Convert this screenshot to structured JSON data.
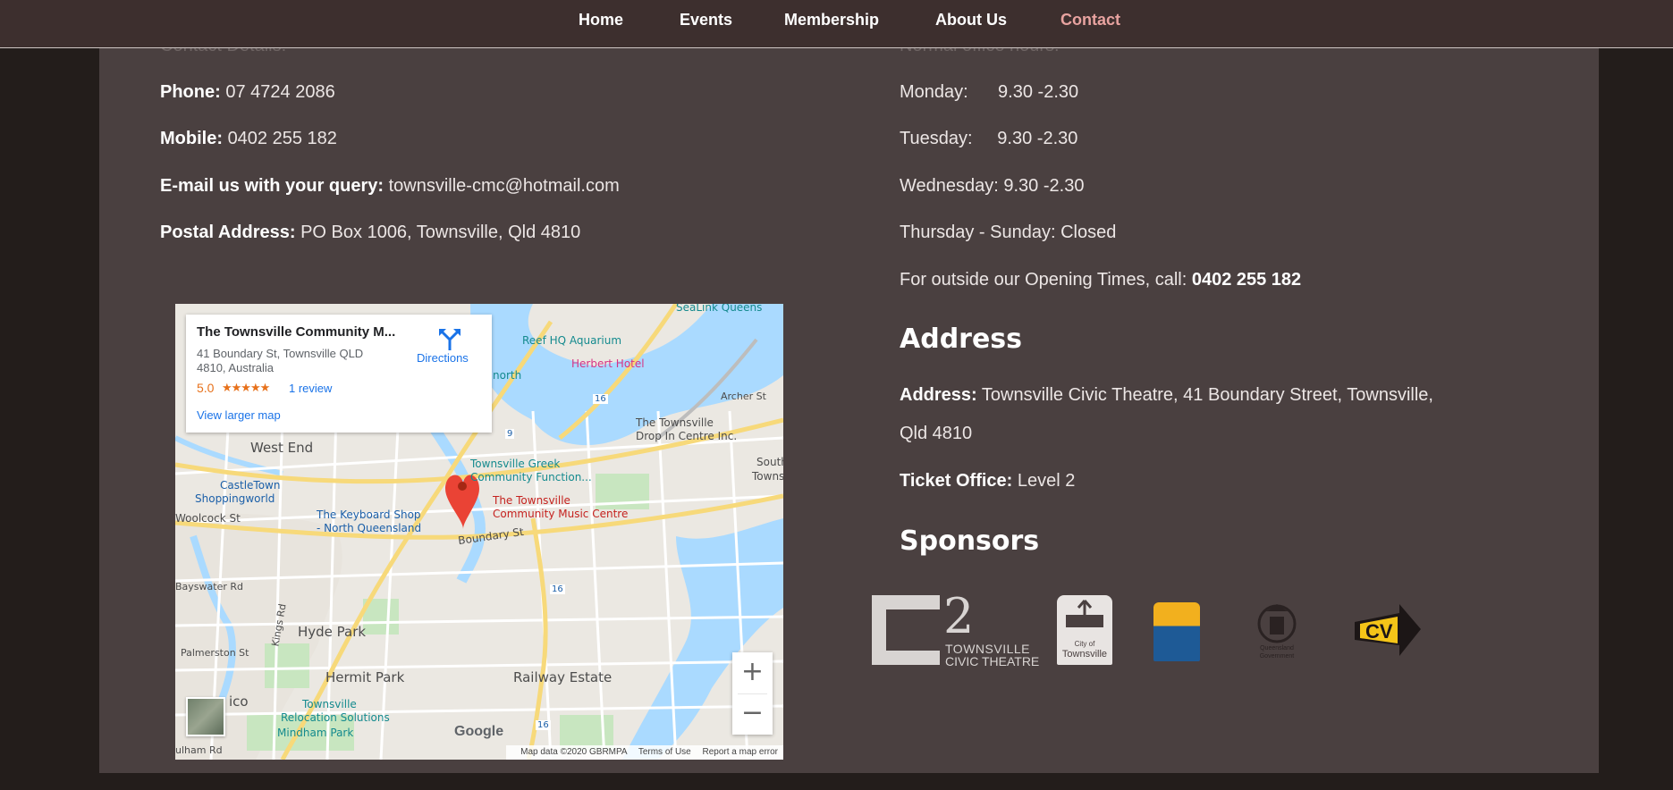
{
  "nav": {
    "items": [
      {
        "label": "Home"
      },
      {
        "label": "Events"
      },
      {
        "label": "Membership"
      },
      {
        "label": "About Us"
      },
      {
        "label": "Contact"
      }
    ]
  },
  "contact": {
    "details_heading": "Contact Details:",
    "phone_label": "Phone:",
    "phone_value": "07 4724 2086",
    "mobile_label": "Mobile:",
    "mobile_value": "0402 255 182",
    "email_label": "E-mail us with your query:",
    "email_value": "townsville-cmc@hotmail.com",
    "postal_label": "Postal Address:",
    "postal_value": "PO Box 1006, Townsville, Qld 4810"
  },
  "hours": {
    "heading": "Normal office hours:",
    "monday": "Monday:      9.30 -2.30",
    "tuesday": "Tuesday:     9.30 -2.30",
    "wednesday": "Wednesday: 9.30 -2.30",
    "thu_sun": "Thursday - Sunday: Closed",
    "outside_text": "For outside our Opening Times, call:",
    "outside_number": "0402 255 182"
  },
  "address": {
    "heading": "Address",
    "address_label": "Address:",
    "address_line1": "Townsville Civic Theatre, 41 Boundary Street, Townsville,",
    "address_line2": "Qld 4810",
    "ticket_label": "Ticket Office:",
    "ticket_value": "Level 2"
  },
  "sponsors": {
    "heading": "Sponsors",
    "items": [
      {
        "name": "Townsville Civic Theatre",
        "mark": "2",
        "line1": "TOWNSVILLE",
        "line2": "CIVIC THEATRE"
      },
      {
        "name": "City of Townsville",
        "line1": "City of",
        "line2": "Townsville"
      },
      {
        "name": "City of Townsville (gold)"
      },
      {
        "name": "Queensland Government",
        "line1": "Queensland",
        "line2": "Government"
      },
      {
        "name": "CV"
      }
    ]
  },
  "map": {
    "card_title": "The Townsville Community M...",
    "card_address": "41 Boundary St, Townsville QLD 4810, Australia",
    "rating": "5.0",
    "stars": "★★★★★",
    "review_link": "1 review",
    "larger_map_link": "View larger map",
    "directions_label": "Directions",
    "labels": {
      "sealink": "SeaLink Queens",
      "reef": "Reef HQ Aquarium",
      "herbert": "Herbert Hotel",
      "north": "north",
      "archer": "Archer St",
      "dropin1": "The Townsville",
      "dropin2": "Drop In Centre Inc.",
      "west_end": "West End",
      "greek1": "Townsville Greek",
      "greek2": "Community Function...",
      "south1": "South",
      "south2": "Townsv",
      "castle1": "CastleTown",
      "castle2": "Shoppingworld",
      "tcmc1": "The Townsville",
      "tcmc2": "Community Music Centre",
      "woolcock": "Woolcock St",
      "keyboard1": "The Keyboard Shop",
      "keyboard2": "- North Queensland",
      "boundary": "Boundary St",
      "bayswater": "Bayswater Rd",
      "kings": "Kings Rd",
      "hyde": "Hyde Park",
      "palmerston": "Palmerston St",
      "hermit": "Hermit Park",
      "railway": "Railway Estate",
      "ico": "ico",
      "reloc1": "Townsville",
      "reloc2": "Relocation Solutions",
      "mindham": "Mindham Park",
      "ulham": "ulham Rd",
      "r9": "9",
      "r16a": "16",
      "r16b": "16",
      "r16c": "16"
    },
    "zoom_in": "+",
    "zoom_out": "−",
    "google": "Google",
    "footer_data": "Map data ©2020 GBRMPA",
    "footer_terms": "Terms of Use",
    "footer_report": "Report a map error"
  }
}
